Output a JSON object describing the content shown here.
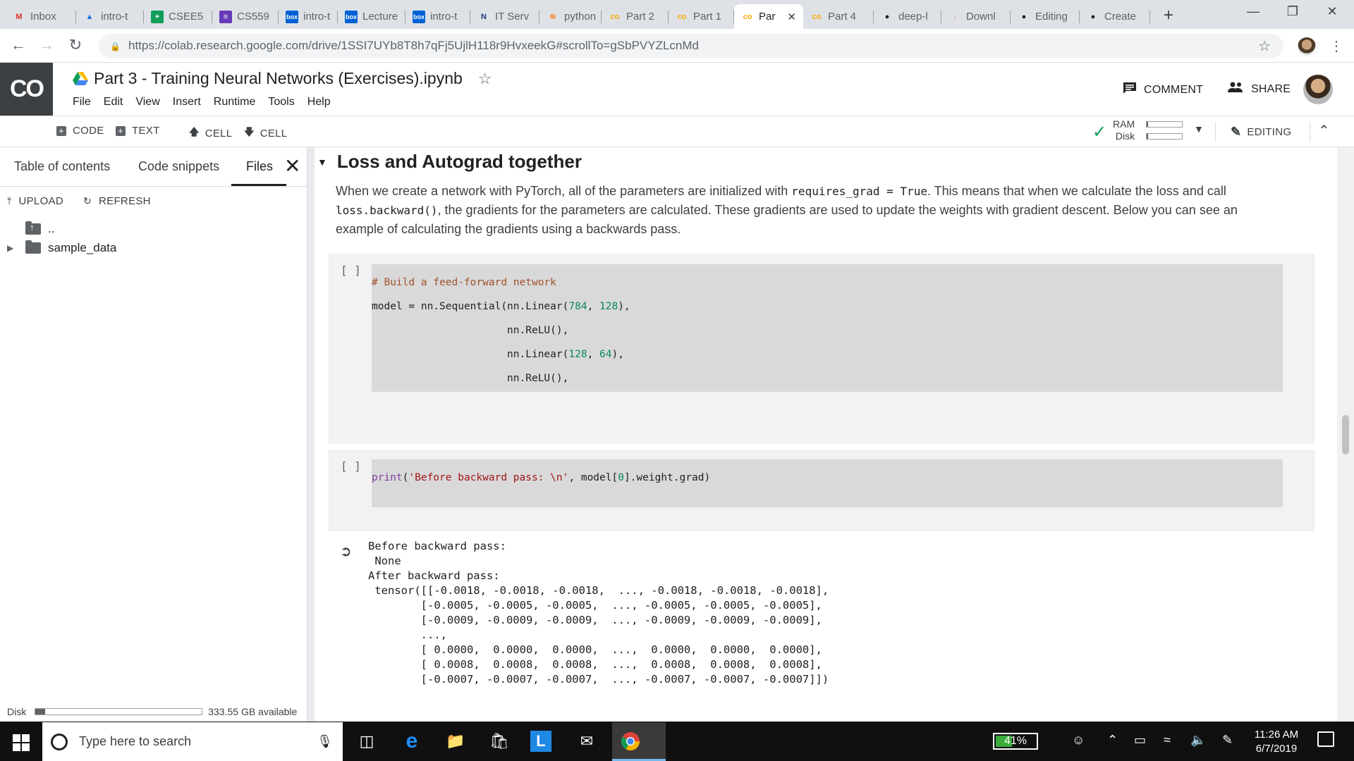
{
  "browser": {
    "tabs": [
      {
        "label": "Inbox",
        "icon": "gmail-icon",
        "color": "#d93025",
        "glyph": "M"
      },
      {
        "label": "intro-t",
        "icon": "drive-icon",
        "color": "#1a73e8",
        "glyph": "▲"
      },
      {
        "label": "CSEE5",
        "icon": "sheets-icon",
        "color": "#0f9d58",
        "glyph": "+"
      },
      {
        "label": "CS559",
        "icon": "forms-icon",
        "color": "#673ab7",
        "glyph": "≡"
      },
      {
        "label": "intro-t",
        "icon": "box-icon",
        "color": "#0061d5",
        "glyph": "box"
      },
      {
        "label": "Lecture",
        "icon": "box-icon",
        "color": "#0061d5",
        "glyph": "box"
      },
      {
        "label": "intro-t",
        "icon": "box-icon",
        "color": "#0061d5",
        "glyph": "box"
      },
      {
        "label": "IT Serv",
        "icon": "servicenow-icon",
        "color": "#1a3d7a",
        "glyph": "N"
      },
      {
        "label": "python",
        "icon": "stackoverflow-icon",
        "color": "#f48024",
        "glyph": "≋"
      },
      {
        "label": "Part 2",
        "icon": "colab-icon",
        "color": "#f9ab00",
        "glyph": "co"
      },
      {
        "label": "Part 1",
        "icon": "colab-icon",
        "color": "#f9ab00",
        "glyph": "co"
      },
      {
        "label": "Par",
        "icon": "colab-icon",
        "color": "#f9ab00",
        "glyph": "co",
        "active": true
      },
      {
        "label": "Part 4",
        "icon": "colab-icon",
        "color": "#f9ab00",
        "glyph": "co"
      },
      {
        "label": "deep-l",
        "icon": "github-icon",
        "color": "#202124",
        "glyph": "●"
      },
      {
        "label": "Downl",
        "icon": "download-icon",
        "color": "#e8a0b8",
        "glyph": "↓"
      },
      {
        "label": "Editing",
        "icon": "github-icon",
        "color": "#202124",
        "glyph": "●"
      },
      {
        "label": "Create",
        "icon": "github-icon",
        "color": "#202124",
        "glyph": "●"
      }
    ],
    "url": "https://colab.research.google.com/drive/1SSI7UYb8T8h7qFj5UjlH118r9HvxeekG#scrollTo=gSbPVYZLcnMd"
  },
  "colab": {
    "logo": "CO",
    "notebook_title": "Part 3 - Training Neural Networks (Exercises).ipynb",
    "menu": [
      "File",
      "Edit",
      "View",
      "Insert",
      "Runtime",
      "Tools",
      "Help"
    ],
    "comment_label": "COMMENT",
    "share_label": "SHARE",
    "toolbar": {
      "code": "CODE",
      "text": "TEXT",
      "cell_up": "CELL",
      "cell_down": "CELL",
      "ram": "RAM",
      "disk": "Disk",
      "ram_fill": 0.04,
      "disk_fill": 0.04,
      "editing": "EDITING"
    }
  },
  "left_panel": {
    "tabs": [
      "Table of contents",
      "Code snippets",
      "Files"
    ],
    "active_tab": "Files",
    "upload": "UPLOAD",
    "refresh": "REFRESH",
    "parent_dir": "..",
    "folder": "sample_data",
    "disk_label": "Disk",
    "disk_fill": 0.06,
    "disk_available": "333.55 GB available"
  },
  "content": {
    "heading": "Loss and Autograd together",
    "para": {
      "p1": "When we create a network with PyTorch, all of the parameters are initialized with ",
      "c1": "requires_grad = True",
      "p2": ". This means that when we calculate the loss and call ",
      "c2": "loss.backward()",
      "p3": ", the gradients for the parameters are calculated. These gradients are used to update the weights with gradient descent. Below you can see an example of calculating the gradients using a backwards pass."
    },
    "cell_marker": "[ ]",
    "output_lines": [
      "Before backward pass:",
      " None",
      "After backward pass:",
      " tensor([[-0.0018, -0.0018, -0.0018,  ..., -0.0018, -0.0018, -0.0018],",
      "        [-0.0005, -0.0005, -0.0005,  ..., -0.0005, -0.0005, -0.0005],",
      "        [-0.0009, -0.0009, -0.0009,  ..., -0.0009, -0.0009, -0.0009],",
      "        ...,",
      "        [ 0.0000,  0.0000,  0.0000,  ...,  0.0000,  0.0000,  0.0000],",
      "        [ 0.0008,  0.0008,  0.0008,  ...,  0.0008,  0.0008,  0.0008],",
      "        [-0.0007, -0.0007, -0.0007,  ..., -0.0007, -0.0007, -0.0007]])"
    ]
  },
  "taskbar": {
    "search_placeholder": "Type here to search",
    "battery": "41%",
    "battery_level": 0.41,
    "time": "11:26 AM",
    "date": "6/7/2019"
  }
}
